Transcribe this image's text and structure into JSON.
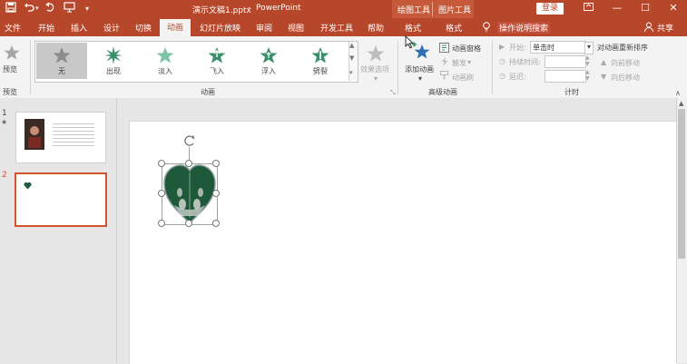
{
  "title_bar": {
    "doc_title": "演示文稿1.pptx",
    "separator": "-",
    "app_name": "PowerPoint",
    "context_tab_drawing": "绘图工具",
    "context_tab_picture": "图片工具",
    "login_label": "登录",
    "qat_save_icon": "save-icon",
    "qat_undo_icon": "undo-icon",
    "qat_redo_icon": "redo-icon",
    "qat_slideshow_icon": "present-icon",
    "qat_more_icon": "customize-qat-icon"
  },
  "tabs": [
    "文件",
    "开始",
    "插入",
    "设计",
    "切换",
    "动画",
    "幻灯片放映",
    "审阅",
    "视图",
    "开发工具",
    "帮助",
    "格式",
    "格式"
  ],
  "active_tab": "动画",
  "search_label": "操作说明搜索",
  "share_label": "共享",
  "ribbon": {
    "preview": {
      "button_label": "预览",
      "group_label": "预览"
    },
    "animation_group": {
      "group_label": "动画",
      "items": [
        {
          "label": "无",
          "selected": true
        },
        {
          "label": "出现"
        },
        {
          "label": "淡入"
        },
        {
          "label": "飞入"
        },
        {
          "label": "浮入"
        },
        {
          "label": "劈裂"
        }
      ],
      "effect_options_label": "效果选项"
    },
    "advanced_group": {
      "group_label": "高级动画",
      "add_animation_label": "添加动画",
      "animation_pane_label": "动画窗格",
      "trigger_label": "触发",
      "animation_painter_label": "动画刷"
    },
    "timing_group": {
      "group_label": "计时",
      "start_label": "开始:",
      "start_value": "单击时",
      "duration_label": "持续时间:",
      "delay_label": "延迟:",
      "reorder_label": "对动画重新排序",
      "move_earlier_label": "向前移动",
      "move_later_label": "向后移动"
    }
  },
  "slides": [
    {
      "number": "1",
      "has_animation_marker": "★"
    },
    {
      "number": "2"
    }
  ],
  "colors": {
    "brand": "#b7472a",
    "accent_selected_border": "#d35230",
    "heart_fill": "#1e5a3a"
  }
}
